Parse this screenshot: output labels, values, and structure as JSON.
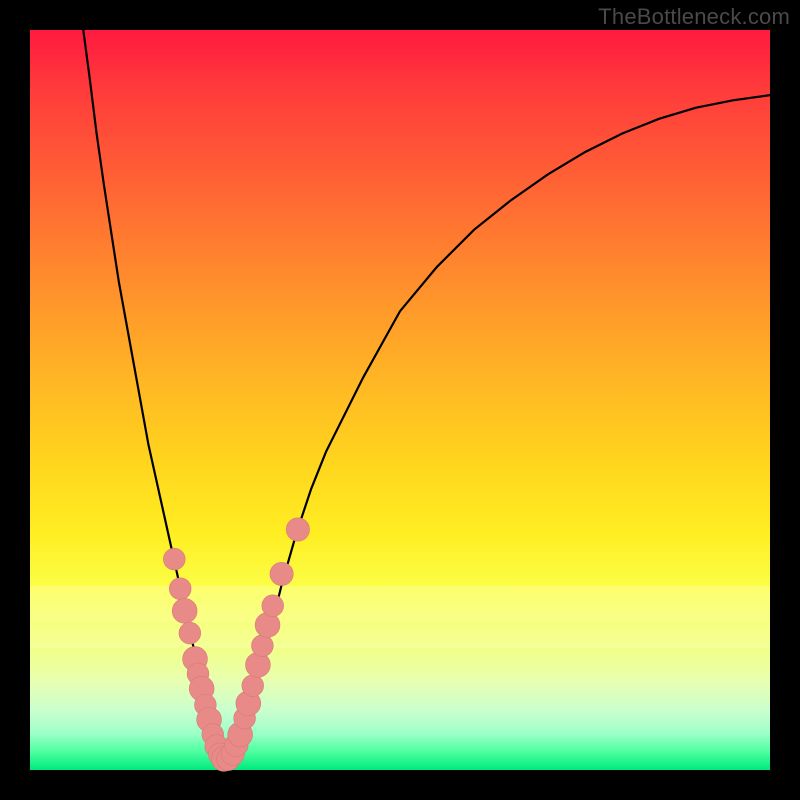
{
  "watermark": "TheBottleneck.com",
  "colors": {
    "frame": "#000000",
    "curve": "#000000",
    "marker_fill": "#e78a88",
    "marker_stroke": "#d87a78"
  },
  "chart_data": {
    "type": "line",
    "title": "",
    "xlabel": "",
    "ylabel": "",
    "xlim": [
      0,
      100
    ],
    "ylim": [
      0,
      100
    ],
    "grid": false,
    "description": "V-shaped bottleneck curve over rainbow gradient (red-high to green-low) with the minimum near x≈26.",
    "series": [
      {
        "name": "bottleneck_curve",
        "x": [
          7.2,
          8,
          9,
          10,
          12,
          14,
          16,
          18,
          20,
          22,
          23,
          24,
          25,
          26,
          27,
          28,
          29,
          30,
          31,
          32,
          33,
          34,
          36,
          38,
          40,
          45,
          50,
          55,
          60,
          65,
          70,
          75,
          80,
          85,
          90,
          95,
          100
        ],
        "y": [
          100,
          94,
          86,
          79,
          66,
          55,
          44,
          35,
          26,
          17,
          13,
          9,
          5,
          1.5,
          1.5,
          3,
          6,
          9,
          13,
          17,
          21,
          25,
          32,
          38,
          43,
          53,
          62,
          68,
          73,
          77,
          80.5,
          83.5,
          86,
          88,
          89.5,
          90.5,
          91.2
        ]
      }
    ],
    "markers": [
      {
        "x": 19.5,
        "y": 28.5,
        "r": 1.4
      },
      {
        "x": 20.3,
        "y": 24.5,
        "r": 1.4
      },
      {
        "x": 20.9,
        "y": 21.5,
        "r": 1.6
      },
      {
        "x": 21.6,
        "y": 18.5,
        "r": 1.4
      },
      {
        "x": 22.3,
        "y": 15.0,
        "r": 1.6
      },
      {
        "x": 22.7,
        "y": 13.0,
        "r": 1.4
      },
      {
        "x": 23.2,
        "y": 11.0,
        "r": 1.6
      },
      {
        "x": 23.7,
        "y": 8.8,
        "r": 1.4
      },
      {
        "x": 24.2,
        "y": 6.8,
        "r": 1.6
      },
      {
        "x": 24.7,
        "y": 4.8,
        "r": 1.4
      },
      {
        "x": 25.2,
        "y": 3.2,
        "r": 1.5
      },
      {
        "x": 25.7,
        "y": 2.1,
        "r": 1.5
      },
      {
        "x": 26.2,
        "y": 1.5,
        "r": 1.6
      },
      {
        "x": 26.8,
        "y": 1.5,
        "r": 1.5
      },
      {
        "x": 27.4,
        "y": 2.2,
        "r": 1.5
      },
      {
        "x": 27.9,
        "y": 3.4,
        "r": 1.5
      },
      {
        "x": 28.4,
        "y": 4.8,
        "r": 1.6
      },
      {
        "x": 29.0,
        "y": 7.0,
        "r": 1.4
      },
      {
        "x": 29.5,
        "y": 9.0,
        "r": 1.6
      },
      {
        "x": 30.1,
        "y": 11.4,
        "r": 1.4
      },
      {
        "x": 30.8,
        "y": 14.2,
        "r": 1.6
      },
      {
        "x": 31.4,
        "y": 16.8,
        "r": 1.4
      },
      {
        "x": 32.1,
        "y": 19.6,
        "r": 1.6
      },
      {
        "x": 32.8,
        "y": 22.2,
        "r": 1.4
      },
      {
        "x": 34.0,
        "y": 26.5,
        "r": 1.5
      },
      {
        "x": 36.2,
        "y": 32.5,
        "r": 1.5
      }
    ]
  }
}
